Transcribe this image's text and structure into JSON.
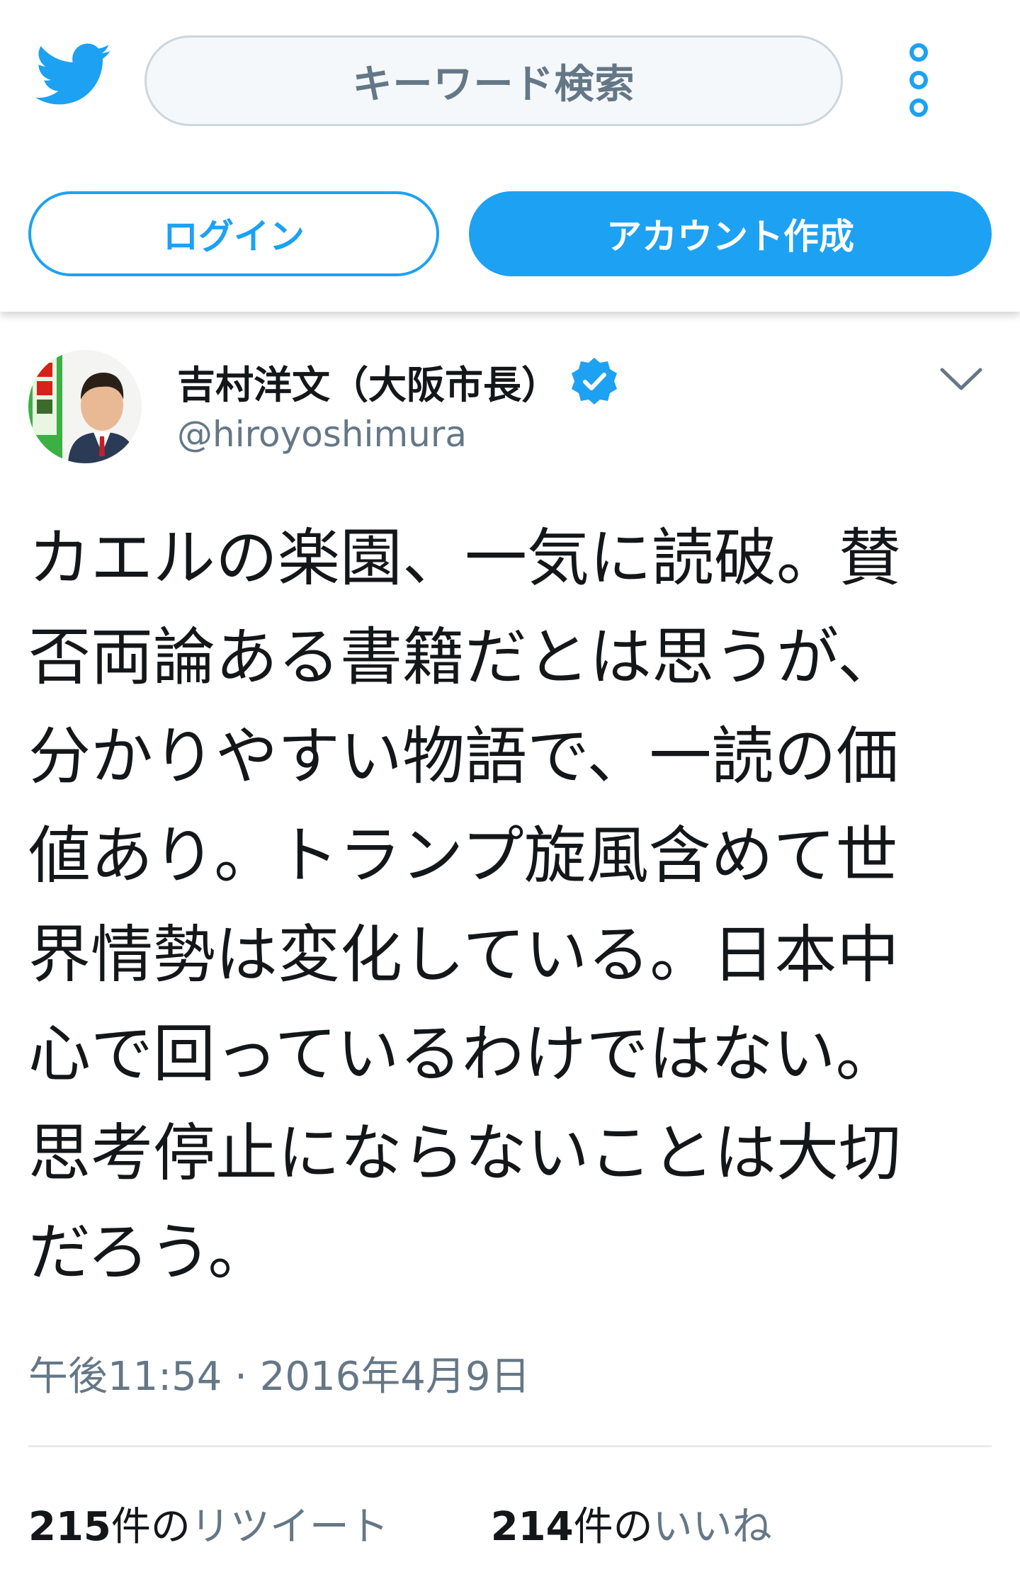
{
  "header": {
    "logo_icon": "twitter-bird-icon",
    "search_placeholder": "キーワード検索",
    "more_icon": "more-vertical-icon",
    "login_label": "ログイン",
    "signup_label": "アカウント作成"
  },
  "tweet": {
    "display_name": "吉村洋文（大阪市長）",
    "verified_icon": "verified-badge-icon",
    "handle": "@hiroyoshimura",
    "caret_icon": "chevron-down-icon",
    "text_lines": [
      "カエルの楽園、一気に読破。賛",
      "否両論ある書籍だとは思うが、",
      "分かりやすい物語で、一読の価",
      "値あり。トランプ旋風含めて世",
      "界情勢は変化している。日本中",
      "心で回っているわけではない。",
      "思考停止にならないことは大切",
      "だろう。"
    ],
    "timestamp": "午後11:54 · 2016年4月9日"
  },
  "stats": {
    "retweets": {
      "count": "215",
      "unit": "件の",
      "label": "リツイート"
    },
    "likes": {
      "count": "214",
      "unit": "件の",
      "label": "いいね"
    }
  },
  "colors": {
    "brand_blue": "#1da1f2",
    "text_primary": "#14171a",
    "text_secondary": "#657786",
    "border": "#ccd6dd",
    "search_bg": "#f5f8fa"
  }
}
